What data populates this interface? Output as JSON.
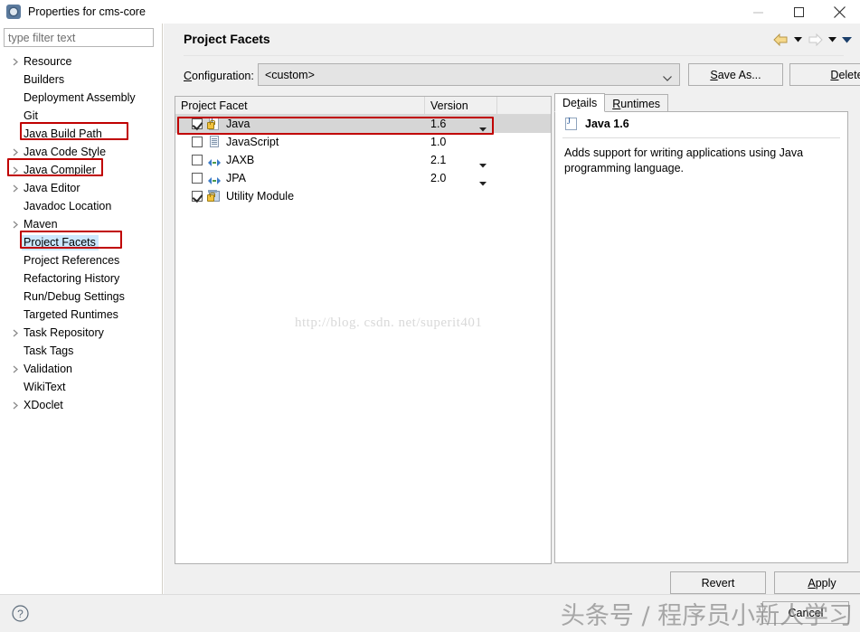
{
  "window": {
    "title": "Properties for cms-core",
    "icon": "properties-gear-icon",
    "controls": {
      "minimize": "minimize-icon",
      "maximize": "maximize-icon",
      "close": "close-icon"
    }
  },
  "sidebar": {
    "filter_placeholder": "type filter text",
    "filter_value": "",
    "items": [
      {
        "label": "Resource",
        "expandable": true,
        "selected": false,
        "annotated": false
      },
      {
        "label": "Builders",
        "expandable": false,
        "selected": false,
        "annotated": false
      },
      {
        "label": "Deployment Assembly",
        "expandable": false,
        "selected": false,
        "annotated": false
      },
      {
        "label": "Git",
        "expandable": false,
        "selected": false,
        "annotated": false
      },
      {
        "label": "Java Build Path",
        "expandable": false,
        "selected": false,
        "annotated": true
      },
      {
        "label": "Java Code Style",
        "expandable": true,
        "selected": false,
        "annotated": false
      },
      {
        "label": "Java Compiler",
        "expandable": true,
        "selected": false,
        "annotated": true
      },
      {
        "label": "Java Editor",
        "expandable": true,
        "selected": false,
        "annotated": false
      },
      {
        "label": "Javadoc Location",
        "expandable": false,
        "selected": false,
        "annotated": false
      },
      {
        "label": "Maven",
        "expandable": true,
        "selected": false,
        "annotated": false
      },
      {
        "label": "Project Facets",
        "expandable": false,
        "selected": true,
        "annotated": true
      },
      {
        "label": "Project References",
        "expandable": false,
        "selected": false,
        "annotated": false
      },
      {
        "label": "Refactoring History",
        "expandable": false,
        "selected": false,
        "annotated": false
      },
      {
        "label": "Run/Debug Settings",
        "expandable": false,
        "selected": false,
        "annotated": false
      },
      {
        "label": "Targeted Runtimes",
        "expandable": false,
        "selected": false,
        "annotated": false
      },
      {
        "label": "Task Repository",
        "expandable": true,
        "selected": false,
        "annotated": false
      },
      {
        "label": "Task Tags",
        "expandable": false,
        "selected": false,
        "annotated": false
      },
      {
        "label": "Validation",
        "expandable": true,
        "selected": false,
        "annotated": false
      },
      {
        "label": "WikiText",
        "expandable": false,
        "selected": false,
        "annotated": false
      },
      {
        "label": "XDoclet",
        "expandable": true,
        "selected": false,
        "annotated": false
      }
    ]
  },
  "page": {
    "title": "Project Facets",
    "nav": {
      "back_icon": "back-arrow-icon",
      "forward_icon": "forward-arrow-icon",
      "menu_icon": "chevron-down-icon"
    }
  },
  "configuration": {
    "label": "Configuration:",
    "label_mnemonic": "C",
    "value": "<custom>",
    "save_as_label": "Save As...",
    "save_as_mnemonic": "S",
    "delete_label": "Delete",
    "delete_mnemonic": "D"
  },
  "facets_table": {
    "columns": [
      "Project Facet",
      "Version"
    ],
    "rows": [
      {
        "name": "Java",
        "icon": "java-locked-icon",
        "checked": true,
        "version": "1.6",
        "has_version_dropdown": true,
        "selected": true,
        "annotated": true
      },
      {
        "name": "JavaScript",
        "icon": "javascript-doc-icon",
        "checked": false,
        "version": "1.0",
        "has_version_dropdown": false,
        "selected": false,
        "annotated": false
      },
      {
        "name": "JAXB",
        "icon": "jaxb-arrows-icon",
        "checked": false,
        "version": "2.1",
        "has_version_dropdown": true,
        "selected": false,
        "annotated": false
      },
      {
        "name": "JPA",
        "icon": "jpa-arrows-icon",
        "checked": false,
        "version": "2.0",
        "has_version_dropdown": true,
        "selected": false,
        "annotated": false
      },
      {
        "name": "Utility Module",
        "icon": "module-locked-icon",
        "checked": true,
        "version": "",
        "has_version_dropdown": false,
        "selected": false,
        "annotated": false
      }
    ]
  },
  "details": {
    "tabs": [
      {
        "label": "Details",
        "mnemonic": "t",
        "active": true
      },
      {
        "label": "Runtimes",
        "mnemonic": "R",
        "active": false
      }
    ],
    "facet_icon": "java-icon",
    "facet_title": "Java 1.6",
    "description": "Adds support for writing applications using Java programming language."
  },
  "footer": {
    "revert_label": "Revert",
    "apply_label": "Apply",
    "apply_mnemonic": "A",
    "cancel_label": "Cancel",
    "help_icon": "help-question-icon"
  },
  "watermarks": {
    "center_url": "http://blog. csdn. net/superit401",
    "bottom_text": "头条号 / 程序员小新人学习"
  },
  "colors": {
    "annotation_red": "#c00000",
    "selection_blue": "#cce8ff",
    "row_selection_gray": "#d6d6d6",
    "dialog_gray": "#f0f0f0"
  }
}
